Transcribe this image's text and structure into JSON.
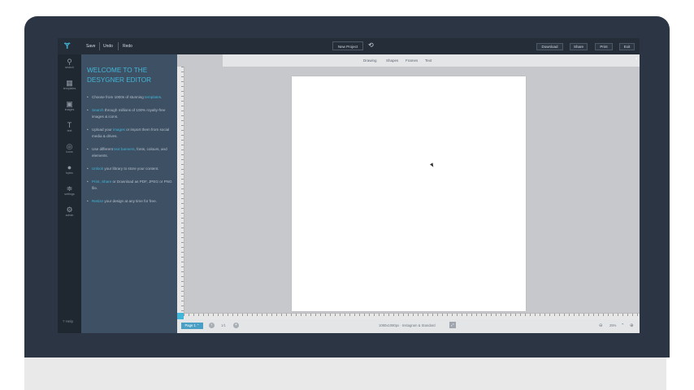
{
  "topbar": {
    "save": "Save",
    "undo": "Undo",
    "redo": "Redo",
    "project_name": "New Project",
    "buttons": [
      "Download",
      "Share",
      "Print",
      "Exit"
    ]
  },
  "nav": [
    {
      "label": "search"
    },
    {
      "label": "templates"
    },
    {
      "label": "images"
    },
    {
      "label": "text"
    },
    {
      "label": "icons"
    },
    {
      "label": "bytes"
    },
    {
      "label": "settings"
    },
    {
      "label": "admin"
    }
  ],
  "panel": {
    "title": "WELCOME TO THE DESYGNER EDITOR",
    "items": [
      {
        "pre": "Choose from 1000s of stunning ",
        "hl": "templates",
        "post": "."
      },
      {
        "pre": "",
        "hl": "Search",
        "post": " through millions of 100% royalty-free images & icons."
      },
      {
        "pre": "Upload your ",
        "hl": "images",
        "post": " or import them from social media & drives."
      },
      {
        "pre": "Use different ",
        "hl": "text banners",
        "post": ", fonts, colours, and elements."
      },
      {
        "pre": "",
        "hl": "Unlock",
        "post": " your library to store your content."
      },
      {
        "pre": "",
        "hl": "Print, Share",
        "post": " or Download as PDF, JPEG or PNG file."
      },
      {
        "pre": "",
        "hl": "Resize",
        "post": " your design at any time for free."
      }
    ],
    "help": "? Help"
  },
  "subtabs": [
    "Drawing",
    "Shapes",
    "Frames",
    "Text"
  ],
  "bottom": {
    "page_label": "Page 1 ⌃",
    "page_no": "1/1",
    "dims": "1080x1080px · Instagram & Standard",
    "zoom": "25%"
  }
}
